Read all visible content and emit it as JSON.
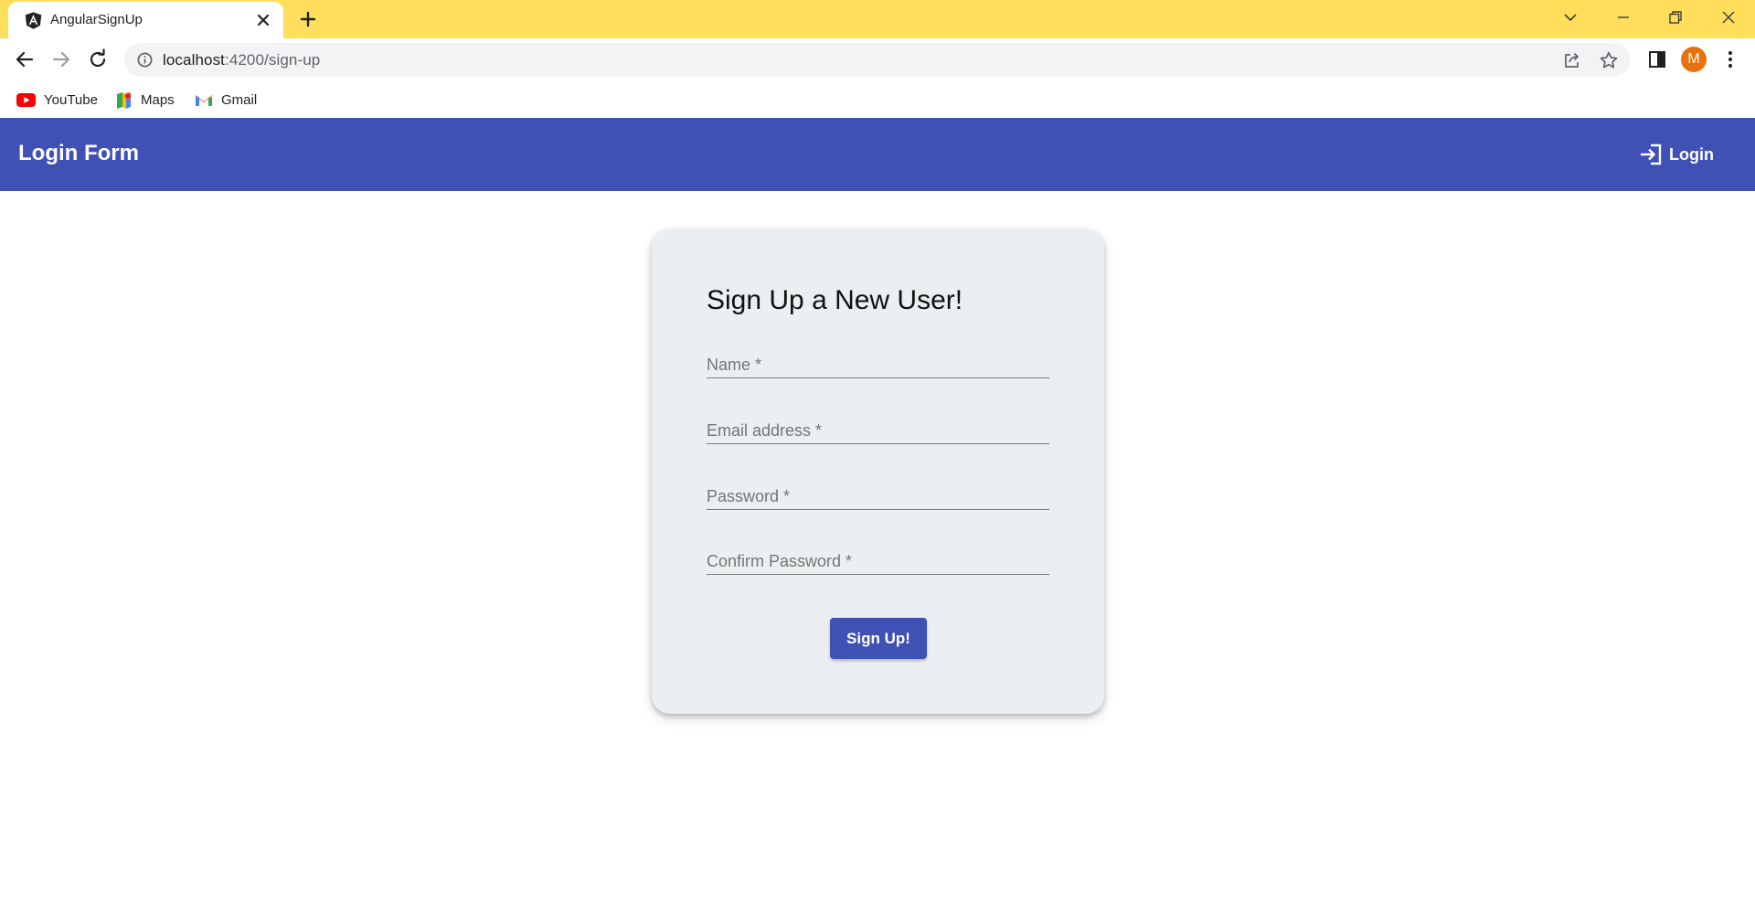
{
  "browser": {
    "tab_title": "AngularSignUp",
    "url_host": "localhost",
    "url_rest": ":4200/sign-up",
    "profile_initial": "M",
    "bookmarks": [
      "YouTube",
      "Maps",
      "Gmail"
    ]
  },
  "app": {
    "title": "Login Form",
    "login_label": "Login",
    "accent_color": "#3f51b5"
  },
  "form": {
    "heading": "Sign Up a New User!",
    "fields": [
      {
        "placeholder": "Name *"
      },
      {
        "placeholder": "Email address *"
      },
      {
        "placeholder": "Password *"
      },
      {
        "placeholder": "Confirm Password *"
      }
    ],
    "submit_label": "Sign Up!"
  },
  "icons": [
    "angular-icon",
    "close-icon",
    "plus-icon",
    "chevron-down-icon",
    "minimize-icon",
    "restore-icon",
    "window-close-icon",
    "back-icon",
    "forward-icon",
    "reload-icon",
    "info-icon",
    "share-icon",
    "star-icon",
    "side-panel-icon",
    "kebab-menu-icon",
    "youtube-icon",
    "maps-icon",
    "gmail-icon",
    "login-icon"
  ]
}
